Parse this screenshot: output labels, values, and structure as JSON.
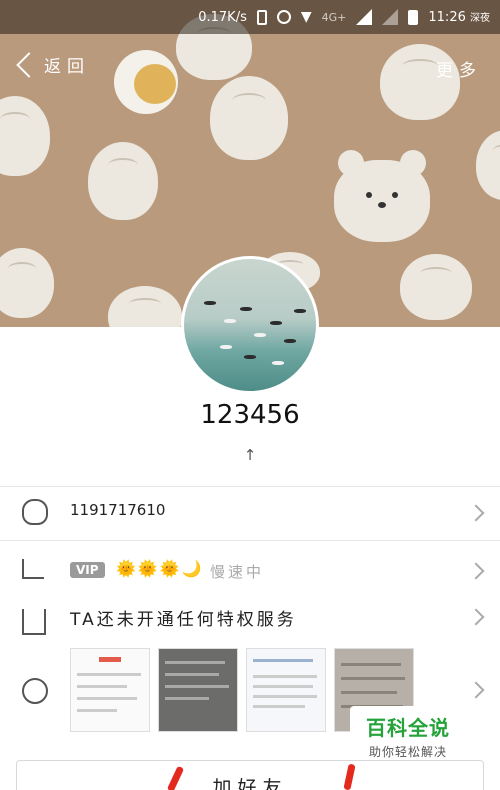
{
  "status_bar": {
    "network_speed": "0.17K/s",
    "network_type": "4G+",
    "time": "11:26",
    "time_suffix": "深夜"
  },
  "nav": {
    "back_label": "返回",
    "more_label": "更多"
  },
  "profile": {
    "username": "123456",
    "level_mark": "↑"
  },
  "rows": {
    "qq_number": "1191717610",
    "vip_badge": "VIP",
    "vip_level_icons": "🌞🌞🌞🌙",
    "vip_status": "慢速中",
    "privilege_text": "TA还未开通任何特权服务"
  },
  "add_friend_label": "加好友",
  "watermark": {
    "title": "百科全说",
    "subtitle": "助你轻松解决"
  },
  "colors": {
    "cover_bg": "#b99a7d",
    "watermark_green": "#25a33a",
    "red_mark": "#e42a1f"
  }
}
